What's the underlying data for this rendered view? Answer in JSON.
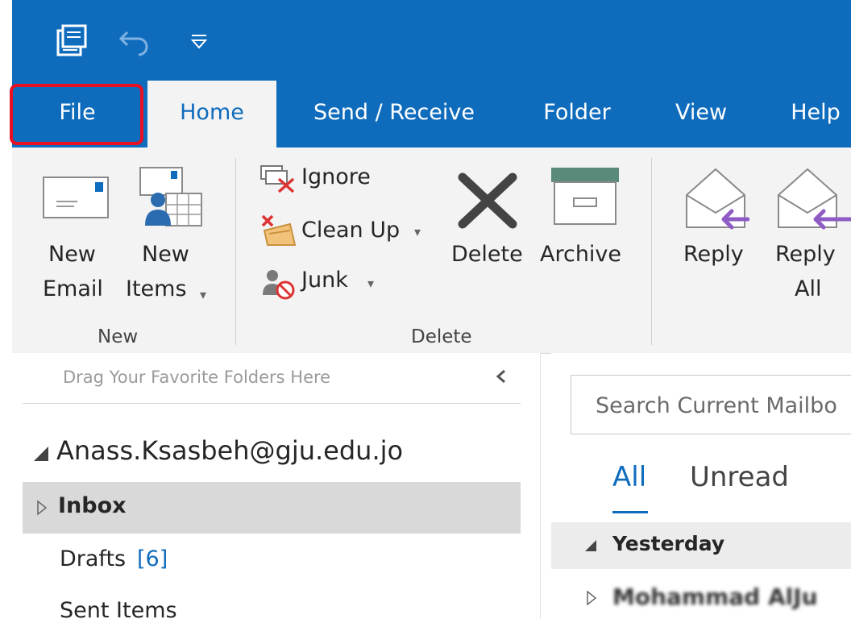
{
  "tabs": {
    "file": "File",
    "home": "Home",
    "send_receive": "Send / Receive",
    "folder": "Folder",
    "view": "View",
    "help": "Help"
  },
  "ribbon": {
    "new_email": [
      "New",
      "Email"
    ],
    "new_items": [
      "New",
      "Items"
    ],
    "group_new": "New",
    "ignore": "Ignore",
    "clean_up": "Clean Up",
    "junk": "Junk",
    "delete": "Delete",
    "archive": "Archive",
    "group_delete": "Delete",
    "reply": "Reply",
    "reply_all": [
      "Reply",
      "All"
    ]
  },
  "nav": {
    "favorites_hint": "Drag Your Favorite Folders Here",
    "account": "Anass.Ksasbeh@gju.edu.jo",
    "inbox": "Inbox",
    "drafts": "Drafts",
    "drafts_count": "[6]",
    "sent_items": "Sent Items"
  },
  "mail": {
    "search_placeholder": "Search Current Mailbo",
    "filter_all": "All",
    "filter_unread": "Unread",
    "group_yesterday": "Yesterday",
    "sender_blurred": "Mohammad AlJu"
  },
  "colors": {
    "accent": "#0f6cbd",
    "highlight": "#e81123",
    "reply_arrow": "#8e5cc4"
  }
}
